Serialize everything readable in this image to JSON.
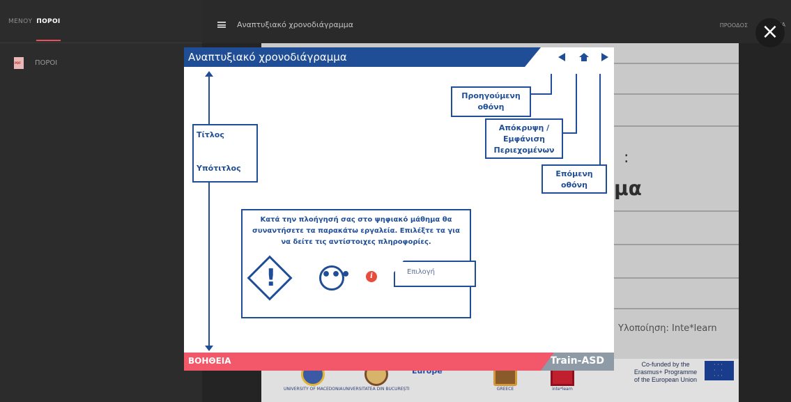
{
  "sidebar": {
    "menu_label": "ΜΕΝΟΥ",
    "poroi_tab": "ΠΟΡΟΙ",
    "items": [
      {
        "label": "ΠΟΡΟΙ",
        "icon": "pdf-icon"
      }
    ]
  },
  "header": {
    "title": "Αναπτυξιακό χρονοδιάγραμμα",
    "progress_label": "ΠΡΟΟΔΟΣ",
    "help_label": "ΒΟΗΘΕΙΑ"
  },
  "background": {
    "line1": ":",
    "line2": "μα",
    "credit": "Υλοποίηση: Inte*learn",
    "logos": [
      {
        "name": "UNIVERSITY OF MACEDONIA"
      },
      {
        "name": "UNIVERSITATEA DIN BUCUREȘTI"
      },
      {
        "name": "Europe"
      },
      {
        "name": "GREECE"
      },
      {
        "name": "inte*learn"
      }
    ],
    "cofunded": "Co-funded by the Erasmus+ Programme of the European Union"
  },
  "modal": {
    "title": "Αναπτυξιακό χρονοδιάγραμμα",
    "labels": {
      "title_box_1": "Τίτλος",
      "title_box_2": "Υπότιτλος",
      "prev_screen": "Προηγούμενη οθόνη",
      "toggle_contents": "Απόκρυψη / Εμφάνιση Περιεχομένων",
      "next_screen": "Επόμενη οθόνη"
    },
    "info_text": "Κατά την πλοήγησή σας στο ψηφιακό μάθημα θα συναντήσετε τα παρακάτω εργαλεία. Επιλέξτε τα για να δείτε τις αντίστοιχες πληροφορίες.",
    "choice_label": "Επιλογή",
    "footer_help": "ΒΟΗΘΕΙΑ",
    "footer_brand": "Train-ASD",
    "colors": {
      "primary": "#1f4e96",
      "footer": "#f2576a",
      "info_icon": "#e74c3c"
    }
  },
  "close_label": "×"
}
